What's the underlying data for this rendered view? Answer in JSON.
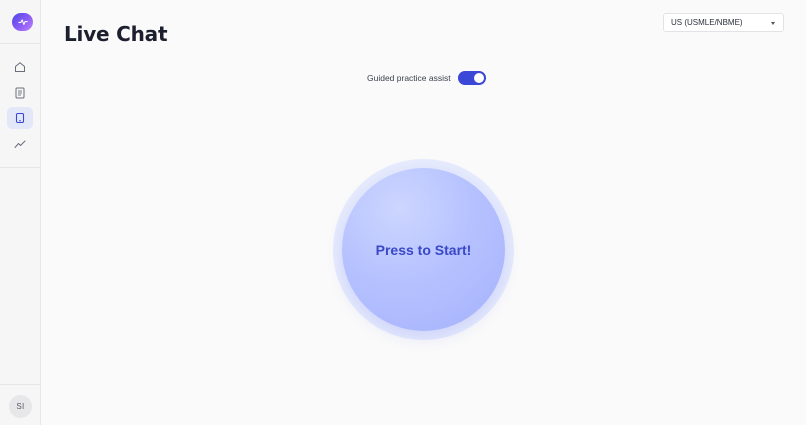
{
  "app": {
    "page_title": "Live Chat"
  },
  "sidebar": {
    "logo_icon": "pulse-logo-icon",
    "items": [
      {
        "name": "home",
        "icon": "home-icon",
        "active": false
      },
      {
        "name": "documents",
        "icon": "document-icon",
        "active": false
      },
      {
        "name": "live-chat",
        "icon": "tablet-icon",
        "active": true
      },
      {
        "name": "analytics",
        "icon": "trend-icon",
        "active": false
      }
    ],
    "avatar_initials": "SI"
  },
  "region_select": {
    "selected": "US (USMLE/NBME)"
  },
  "assist": {
    "label": "Guided practice assist",
    "enabled": true
  },
  "start": {
    "label": "Press to Start!"
  },
  "colors": {
    "accent": "#3b47d6",
    "button_text": "#3a48c8",
    "button_fill": "#b6c2ff",
    "halo": "#e6ebfd",
    "nav_active_bg": "#e3e8f9"
  }
}
